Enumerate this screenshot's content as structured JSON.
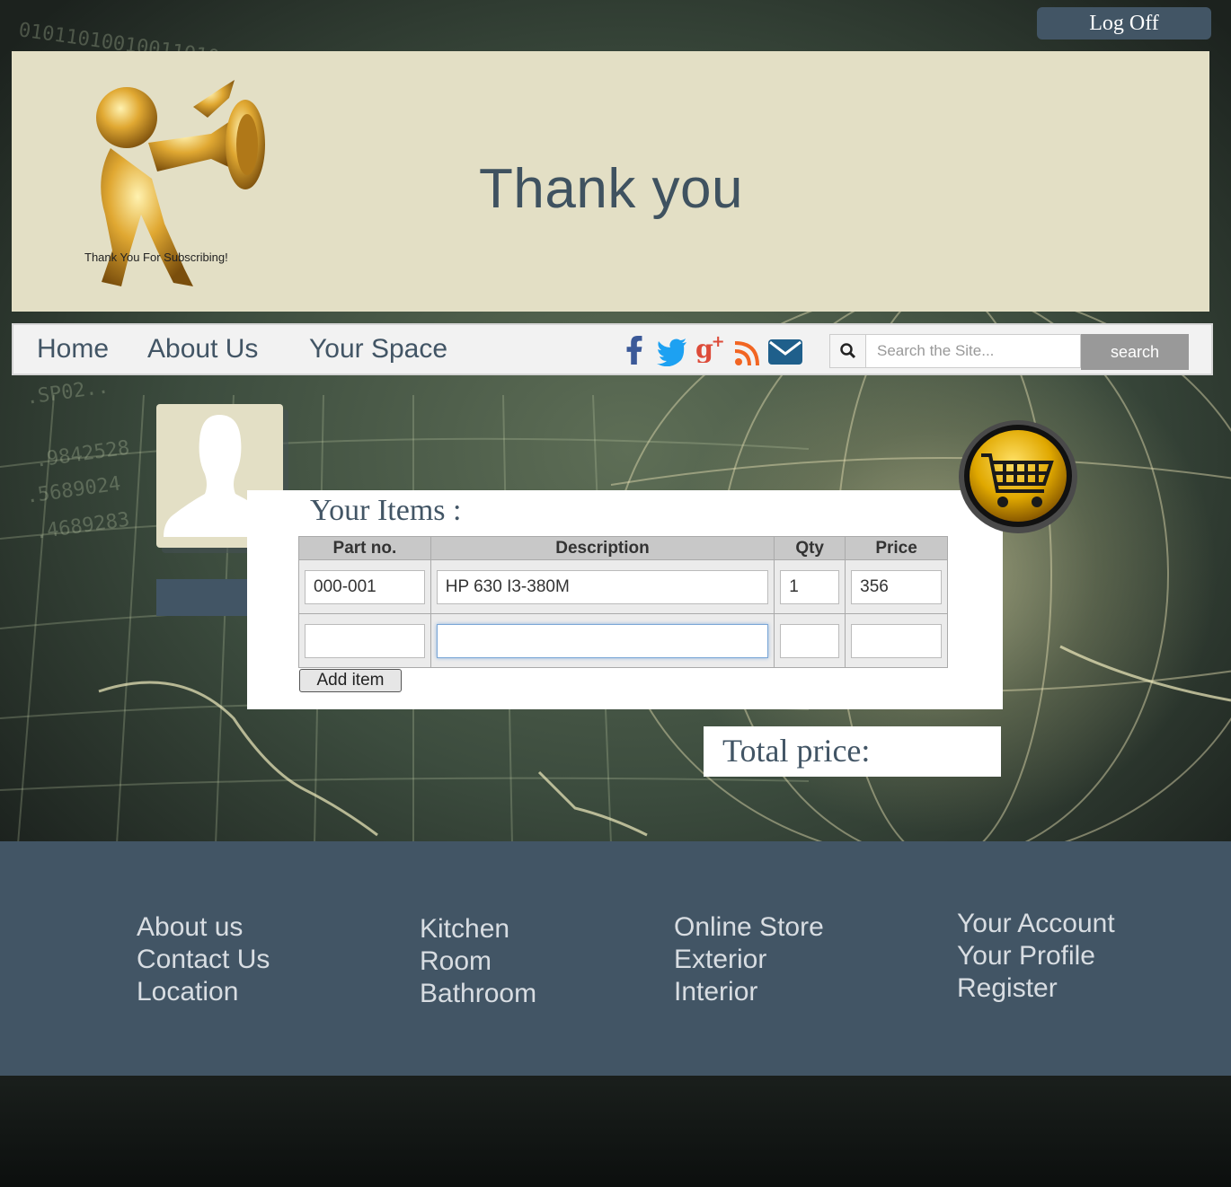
{
  "header": {
    "logoff_label": "Log Off",
    "title": "Thank you",
    "mascot_caption": "Thank You For Subscribing!"
  },
  "nav": {
    "links": [
      "Home",
      "About Us",
      "Your Space"
    ],
    "social_icons": [
      "facebook-icon",
      "twitter-icon",
      "google-plus-icon",
      "rss-icon",
      "email-icon"
    ],
    "search_placeholder": "Search the Site...",
    "search_button": "search"
  },
  "items": {
    "heading": "Your Items :",
    "columns": [
      "Part no.",
      "Description",
      "Qty",
      "Price"
    ],
    "rows": [
      {
        "part": "000-001",
        "description": "HP 630 I3-380M",
        "qty": "1",
        "price": "356"
      },
      {
        "part": "",
        "description": "",
        "qty": "",
        "price": ""
      }
    ],
    "add_button": "Add item"
  },
  "total": {
    "label": "Total price:"
  },
  "footer": {
    "columns": [
      [
        "About us",
        "Contact Us",
        "Location"
      ],
      [
        "Kitchen",
        "Room",
        "Bathroom"
      ],
      [
        "Online Store",
        "Exterior",
        "Interior"
      ],
      [
        "Your Account",
        "Your Profile",
        "Register"
      ]
    ]
  },
  "colors": {
    "primary_slate": "#425565",
    "banner_beige": "#e3dfc5",
    "cart_gold": "#e0a800"
  }
}
